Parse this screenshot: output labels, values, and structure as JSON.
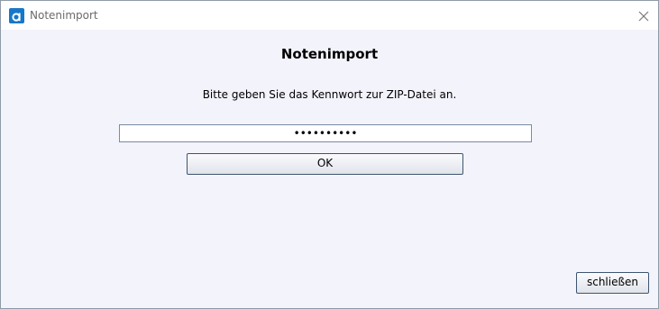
{
  "window": {
    "title": "Notenimport",
    "icon": "app-a-icon",
    "close_icon": "close-icon"
  },
  "dialog": {
    "heading": "Notenimport",
    "prompt": "Bitte geben Sie das Kennwort zur ZIP-Datei an.",
    "password_value": "••••••••••",
    "ok_label": "OK",
    "close_label": "schließen"
  }
}
